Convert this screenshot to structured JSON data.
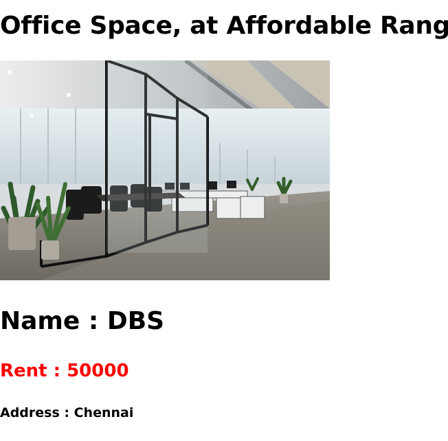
{
  "page": {
    "title": "Office Space, at Affordable Range"
  },
  "listing": {
    "image_alt": "Office Space",
    "name_text": "Name : DBS",
    "rent_text": "Rent : 50000",
    "address_text": "Address : Chennai"
  },
  "colors": {
    "rent": "#ff0000",
    "text": "#000000",
    "background": "#ffffff"
  }
}
